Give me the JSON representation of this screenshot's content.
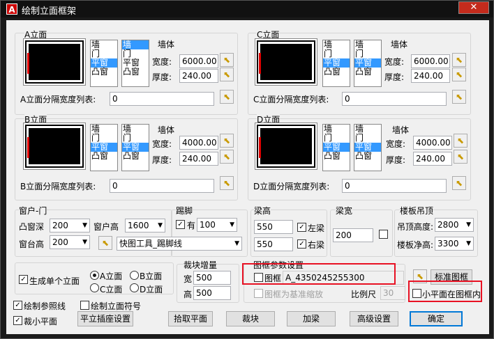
{
  "window": {
    "title": "绘制立面框架",
    "app_icon": "A",
    "close": "✕",
    "accent": "#0078d7",
    "highlight": "#e81123"
  },
  "wall_list": [
    "墙",
    "门",
    "平窗",
    "凸窗"
  ],
  "panels": {
    "A": {
      "title": "A立面",
      "list1_sel": 2,
      "list2_sel": 0,
      "wall": "墙体",
      "width_label": "宽度:",
      "width": "6000.00",
      "thick_label": "厚度:",
      "thick": "240.00",
      "split_label": "A立面分隔宽度列表:",
      "split": "0"
    },
    "C": {
      "title": "C立面",
      "list1_sel": 2,
      "list2_sel": 2,
      "wall": "墙体",
      "width_label": "宽度:",
      "width": "6000.00",
      "thick_label": "厚度:",
      "thick": "240.00",
      "split_label": "C立面分隔宽度列表:",
      "split": "0"
    },
    "B": {
      "title": "B立面",
      "list1_sel": 2,
      "list2_sel": 2,
      "wall": "墙体",
      "width_label": "宽度:",
      "width": "4000.00",
      "thick_label": "厚度:",
      "thick": "240.00",
      "split_label": "B立面分隔宽度列表:",
      "split": "0"
    },
    "D": {
      "title": "D立面",
      "list1_sel": 2,
      "list2_sel": 2,
      "wall": "墙体",
      "width_label": "宽度:",
      "width": "4000.00",
      "thick_label": "厚度:",
      "thick": "240.00",
      "split_label": "D立面分隔宽度列表:",
      "split": "0"
    }
  },
  "window_door": {
    "title": "窗户-门",
    "bay_depth_label": "凸窗深",
    "bay_depth": "200",
    "win_height_label": "窗户高",
    "win_height": "1600",
    "sill_label": "窗台高",
    "sill": "200"
  },
  "kick": {
    "title": "踢脚",
    "has_label": "有",
    "has_checked": true,
    "value": "100",
    "tool": "快图工具_踢脚线"
  },
  "beam_height": {
    "title": "梁高",
    "left_value": "550",
    "left_label": "左梁",
    "right_value": "550",
    "right_label": "右梁"
  },
  "beam_width": {
    "title": "梁宽",
    "value": "200"
  },
  "ceiling": {
    "title": "楼板吊顶",
    "ceiling_label": "吊顶高度:",
    "ceiling_value": "2800",
    "floor_label": "楼板净高:",
    "floor_value": "3300"
  },
  "gen_single": {
    "label": "生成单个立面",
    "checked": true,
    "radios": [
      "A立面",
      "B立面",
      "C立面",
      "D立面"
    ],
    "selected": 0
  },
  "block_inc": {
    "title": "裁块增量",
    "w_label": "宽",
    "w_value": "500",
    "h_label": "高",
    "h_value": "500"
  },
  "frame": {
    "title": "图框参数设置",
    "frame_label": "图框",
    "frame_value": "A_4350245255300",
    "std_button": "标准图框",
    "scale_base_label": "图框为基准缩放",
    "scale_label": "比例尺",
    "scale_value": "30",
    "small_plan_label": "小平面在图框内"
  },
  "bottom": {
    "draw_ref": "绘制参照线",
    "draw_symbol": "绘制立面符号",
    "cut_small": "裁小平面",
    "insert_btn": "平立插座设置",
    "pick_btn": "拾取平面",
    "cut_btn": "裁块",
    "beam_btn": "加梁",
    "adv_btn": "高级设置",
    "ok_btn": "确定"
  },
  "icons": {
    "pick": "cursor-pick-icon",
    "check": "✓",
    "dropdown": "▼"
  }
}
